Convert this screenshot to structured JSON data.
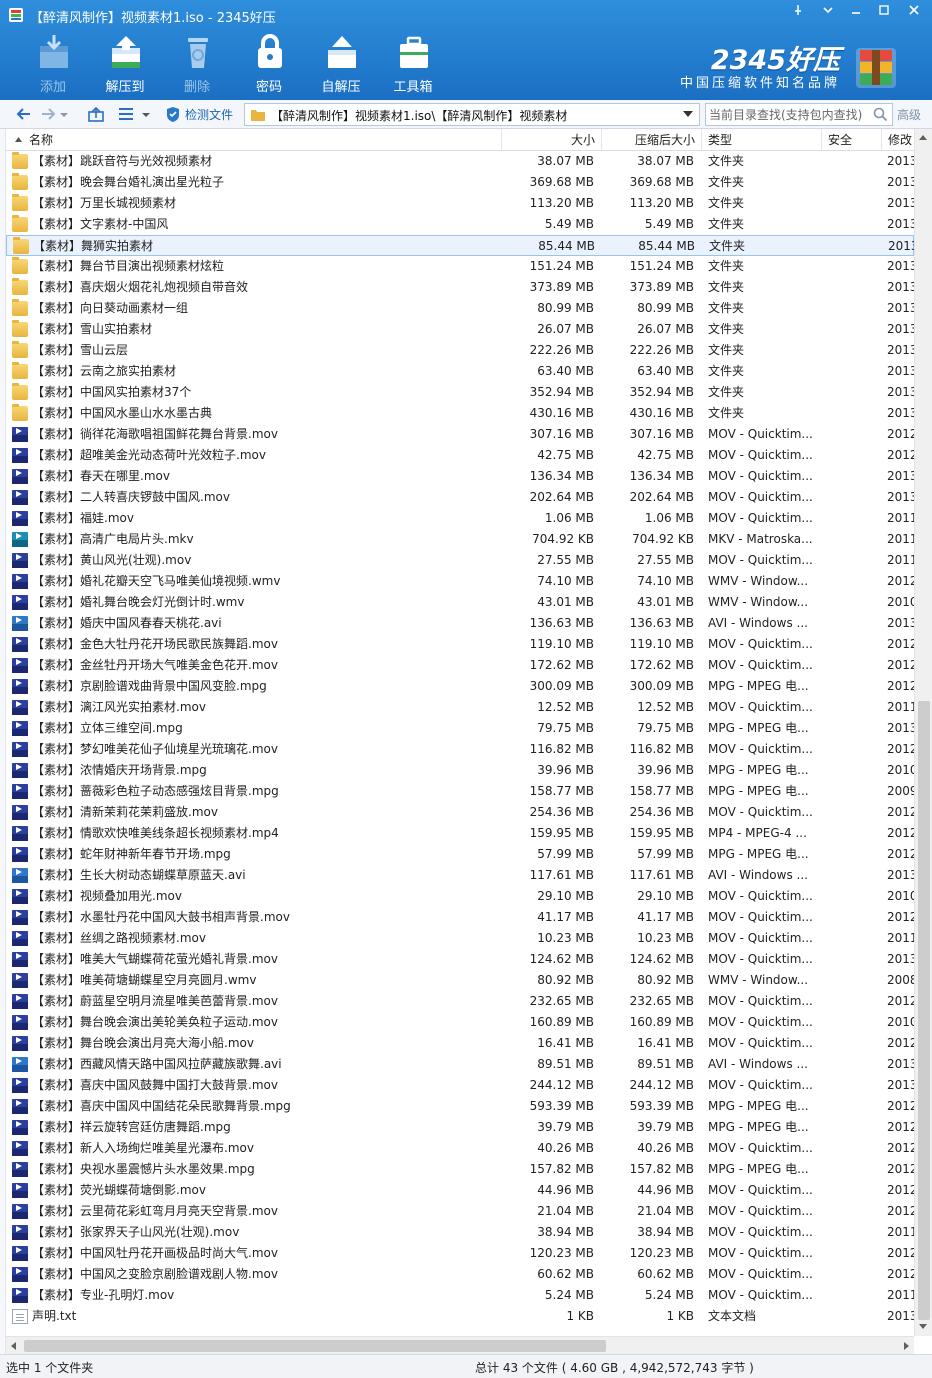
{
  "window": {
    "title": "【醉清风制作】视频素材1.iso - 2345好压",
    "controls": [
      "pin-icon",
      "menu-icon",
      "minimize-icon",
      "maximize-icon",
      "close-icon"
    ]
  },
  "toolbar": {
    "add_label": "添加",
    "extract_label": "解压到",
    "delete_label": "删除",
    "password_label": "密码",
    "sfx_label": "自解压",
    "toolbox_label": "工具箱"
  },
  "brand": {
    "name": "2345好压",
    "slogan": "中国压缩软件知名品牌"
  },
  "addressbar": {
    "detect_label": "检测文件",
    "path": "【醉清风制作】视频素材1.iso\\【醉清风制作】视频素材",
    "search_placeholder": "当前目录查找(支持包内查找)",
    "advanced_label": "高级"
  },
  "columns": {
    "name": "名称",
    "size": "大小",
    "compressed": "压缩后大小",
    "type": "类型",
    "security": "安全",
    "modified": "修改"
  },
  "files": [
    {
      "icon": "folder",
      "name": "【素材】跳跃音符与光效视频素材",
      "size": "38.07 MB",
      "csize": "38.07 MB",
      "type": "文件夹",
      "date": "2013"
    },
    {
      "icon": "folder",
      "name": "【素材】晚会舞台婚礼演出星光粒子",
      "size": "369.68 MB",
      "csize": "369.68 MB",
      "type": "文件夹",
      "date": "2013"
    },
    {
      "icon": "folder",
      "name": "【素材】万里长城视频素材",
      "size": "113.20 MB",
      "csize": "113.20 MB",
      "type": "文件夹",
      "date": "2013"
    },
    {
      "icon": "folder",
      "name": "【素材】文字素材-中国风",
      "size": "5.49 MB",
      "csize": "5.49 MB",
      "type": "文件夹",
      "date": "2013"
    },
    {
      "icon": "folder",
      "name": "【素材】舞狮实拍素材",
      "size": "85.44 MB",
      "csize": "85.44 MB",
      "type": "文件夹",
      "date": "2013",
      "selected": true
    },
    {
      "icon": "folder",
      "name": "【素材】舞台节目演出视频素材炫粒",
      "size": "151.24 MB",
      "csize": "151.24 MB",
      "type": "文件夹",
      "date": "2013"
    },
    {
      "icon": "folder",
      "name": "【素材】喜庆烟火烟花礼炮视频自带音效",
      "size": "373.89 MB",
      "csize": "373.89 MB",
      "type": "文件夹",
      "date": "2013"
    },
    {
      "icon": "folder",
      "name": "【素材】向日葵动画素材一组",
      "size": "80.99 MB",
      "csize": "80.99 MB",
      "type": "文件夹",
      "date": "2013"
    },
    {
      "icon": "folder",
      "name": "【素材】雪山实拍素材",
      "size": "26.07 MB",
      "csize": "26.07 MB",
      "type": "文件夹",
      "date": "2013"
    },
    {
      "icon": "folder",
      "name": "【素材】雪山云层",
      "size": "222.26 MB",
      "csize": "222.26 MB",
      "type": "文件夹",
      "date": "2013"
    },
    {
      "icon": "folder",
      "name": "【素材】云南之旅实拍素材",
      "size": "63.40 MB",
      "csize": "63.40 MB",
      "type": "文件夹",
      "date": "2013"
    },
    {
      "icon": "folder",
      "name": "【素材】中国风实拍素材37个",
      "size": "352.94 MB",
      "csize": "352.94 MB",
      "type": "文件夹",
      "date": "2013"
    },
    {
      "icon": "folder",
      "name": "【素材】中国风水墨山水水墨古典",
      "size": "430.16 MB",
      "csize": "430.16 MB",
      "type": "文件夹",
      "date": "2013"
    },
    {
      "icon": "mov",
      "name": "【素材】徜徉花海歌唱祖国鲜花舞台背景.mov",
      "size": "307.16 MB",
      "csize": "307.16 MB",
      "type": "MOV - Quicktim...",
      "date": "2012"
    },
    {
      "icon": "mov",
      "name": "【素材】超唯美金光动态荷叶光效粒子.mov",
      "size": "42.75 MB",
      "csize": "42.75 MB",
      "type": "MOV - Quicktim...",
      "date": "2012"
    },
    {
      "icon": "mov",
      "name": "【素材】春天在哪里.mov",
      "size": "136.34 MB",
      "csize": "136.34 MB",
      "type": "MOV - Quicktim...",
      "date": "2013"
    },
    {
      "icon": "mov",
      "name": "【素材】二人转喜庆锣鼓中国风.mov",
      "size": "202.64 MB",
      "csize": "202.64 MB",
      "type": "MOV - Quicktim...",
      "date": "2013"
    },
    {
      "icon": "mov",
      "name": "【素材】福娃.mov",
      "size": "1.06 MB",
      "csize": "1.06 MB",
      "type": "MOV - Quicktim...",
      "date": "2011"
    },
    {
      "icon": "mkv",
      "name": "【素材】高清广电局片头.mkv",
      "size": "704.92 KB",
      "csize": "704.92 KB",
      "type": "MKV - Matroska...",
      "date": "2011"
    },
    {
      "icon": "mov",
      "name": "【素材】黄山风光(壮观).mov",
      "size": "27.55 MB",
      "csize": "27.55 MB",
      "type": "MOV - Quicktim...",
      "date": "2011"
    },
    {
      "icon": "wmv",
      "name": "【素材】婚礼花瓣天空飞马唯美仙境视频.wmv",
      "size": "74.10 MB",
      "csize": "74.10 MB",
      "type": "WMV - Window...",
      "date": "2012"
    },
    {
      "icon": "wmv",
      "name": "【素材】婚礼舞台晚会灯光倒计时.wmv",
      "size": "43.01 MB",
      "csize": "43.01 MB",
      "type": "WMV - Window...",
      "date": "2010"
    },
    {
      "icon": "avi",
      "name": "【素材】婚庆中国风春春天桃花.avi",
      "size": "136.63 MB",
      "csize": "136.63 MB",
      "type": "AVI - Windows ...",
      "date": "2013"
    },
    {
      "icon": "mov",
      "name": "【素材】金色大牡丹花开场民歌民族舞蹈.mov",
      "size": "119.10 MB",
      "csize": "119.10 MB",
      "type": "MOV - Quicktim...",
      "date": "2012"
    },
    {
      "icon": "mov",
      "name": "【素材】金丝牡丹开场大气唯美金色花开.mov",
      "size": "172.62 MB",
      "csize": "172.62 MB",
      "type": "MOV - Quicktim...",
      "date": "2012"
    },
    {
      "icon": "mpg",
      "name": "【素材】京剧脸谱戏曲背景中国风变脸.mpg",
      "size": "300.09 MB",
      "csize": "300.09 MB",
      "type": "MPG - MPEG 电...",
      "date": "2012"
    },
    {
      "icon": "mov",
      "name": "【素材】漓江风光实拍素材.mov",
      "size": "12.52 MB",
      "csize": "12.52 MB",
      "type": "MOV - Quicktim...",
      "date": "2011"
    },
    {
      "icon": "mpg",
      "name": "【素材】立体三维空间.mpg",
      "size": "79.75 MB",
      "csize": "79.75 MB",
      "type": "MPG - MPEG 电...",
      "date": "2013"
    },
    {
      "icon": "mov",
      "name": "【素材】梦幻唯美花仙子仙境星光琉璃花.mov",
      "size": "116.82 MB",
      "csize": "116.82 MB",
      "type": "MOV - Quicktim...",
      "date": "2012"
    },
    {
      "icon": "mpg",
      "name": "【素材】浓情婚庆开场背景.mpg",
      "size": "39.96 MB",
      "csize": "39.96 MB",
      "type": "MPG - MPEG 电...",
      "date": "2010"
    },
    {
      "icon": "mpg",
      "name": "【素材】蔷薇彩色粒子动态感强炫目背景.mpg",
      "size": "158.77 MB",
      "csize": "158.77 MB",
      "type": "MPG - MPEG 电...",
      "date": "2009"
    },
    {
      "icon": "mov",
      "name": "【素材】清新茉莉花茉莉盛放.mov",
      "size": "254.36 MB",
      "csize": "254.36 MB",
      "type": "MOV - Quicktim...",
      "date": "2012"
    },
    {
      "icon": "mp4",
      "name": "【素材】情歌欢快唯美线条超长视频素材.mp4",
      "size": "159.95 MB",
      "csize": "159.95 MB",
      "type": "MP4 - MPEG-4 ...",
      "date": "2012"
    },
    {
      "icon": "mpg",
      "name": "【素材】蛇年财神新年春节开场.mpg",
      "size": "57.99 MB",
      "csize": "57.99 MB",
      "type": "MPG - MPEG 电...",
      "date": "2012"
    },
    {
      "icon": "avi",
      "name": "【素材】生长大树动态蝴蝶草原蓝天.avi",
      "size": "117.61 MB",
      "csize": "117.61 MB",
      "type": "AVI - Windows ...",
      "date": "2013"
    },
    {
      "icon": "mov",
      "name": "【素材】视频叠加用光.mov",
      "size": "29.10 MB",
      "csize": "29.10 MB",
      "type": "MOV - Quicktim...",
      "date": "2010"
    },
    {
      "icon": "mov",
      "name": "【素材】水墨牡丹花中国风大鼓书相声背景.mov",
      "size": "41.17 MB",
      "csize": "41.17 MB",
      "type": "MOV - Quicktim...",
      "date": "2012"
    },
    {
      "icon": "mov",
      "name": "【素材】丝绸之路视频素材.mov",
      "size": "10.23 MB",
      "csize": "10.23 MB",
      "type": "MOV - Quicktim...",
      "date": "2011"
    },
    {
      "icon": "mov",
      "name": "【素材】唯美大气蝴蝶荷花萤光婚礼背景.mov",
      "size": "124.62 MB",
      "csize": "124.62 MB",
      "type": "MOV - Quicktim...",
      "date": "2013"
    },
    {
      "icon": "wmv",
      "name": "【素材】唯美荷塘蝴蝶星空月亮圆月.wmv",
      "size": "80.92 MB",
      "csize": "80.92 MB",
      "type": "WMV - Window...",
      "date": "2008"
    },
    {
      "icon": "mov",
      "name": "【素材】蔚蓝星空明月流星唯美芭蕾背景.mov",
      "size": "232.65 MB",
      "csize": "232.65 MB",
      "type": "MOV - Quicktim...",
      "date": "2012"
    },
    {
      "icon": "mov",
      "name": "【素材】舞台晚会演出美轮美奂粒子运动.mov",
      "size": "160.89 MB",
      "csize": "160.89 MB",
      "type": "MOV - Quicktim...",
      "date": "2010"
    },
    {
      "icon": "mov",
      "name": "【素材】舞台晚会演出月亮大海小船.mov",
      "size": "16.41 MB",
      "csize": "16.41 MB",
      "type": "MOV - Quicktim...",
      "date": "2012"
    },
    {
      "icon": "avi",
      "name": "【素材】西藏风情天路中国风拉萨藏族歌舞.avi",
      "size": "89.51 MB",
      "csize": "89.51 MB",
      "type": "AVI - Windows ...",
      "date": "2013"
    },
    {
      "icon": "mov",
      "name": "【素材】喜庆中国风鼓舞中国打大鼓背景.mov",
      "size": "244.12 MB",
      "csize": "244.12 MB",
      "type": "MOV - Quicktim...",
      "date": "2013"
    },
    {
      "icon": "mpg",
      "name": "【素材】喜庆中国风中国结花朵民歌舞背景.mpg",
      "size": "593.39 MB",
      "csize": "593.39 MB",
      "type": "MPG - MPEG 电...",
      "date": "2012"
    },
    {
      "icon": "mpg",
      "name": "【素材】祥云旋转宫廷仿唐舞蹈.mpg",
      "size": "39.79 MB",
      "csize": "39.79 MB",
      "type": "MPG - MPEG 电...",
      "date": "2012"
    },
    {
      "icon": "mov",
      "name": "【素材】新人入场绚烂唯美星光瀑布.mov",
      "size": "40.26 MB",
      "csize": "40.26 MB",
      "type": "MOV - Quicktim...",
      "date": "2012"
    },
    {
      "icon": "mpg",
      "name": "【素材】央视水墨震憾片头水墨效果.mpg",
      "size": "157.82 MB",
      "csize": "157.82 MB",
      "type": "MPG - MPEG 电...",
      "date": "2012"
    },
    {
      "icon": "mov",
      "name": "【素材】荧光蝴蝶荷塘倒影.mov",
      "size": "44.96 MB",
      "csize": "44.96 MB",
      "type": "MOV - Quicktim...",
      "date": "2012"
    },
    {
      "icon": "mov",
      "name": "【素材】云里荷花彩虹弯月月亮天空背景.mov",
      "size": "21.04 MB",
      "csize": "21.04 MB",
      "type": "MOV - Quicktim...",
      "date": "2012"
    },
    {
      "icon": "mov",
      "name": "【素材】张家界天子山风光(壮观).mov",
      "size": "38.94 MB",
      "csize": "38.94 MB",
      "type": "MOV - Quicktim...",
      "date": "2011"
    },
    {
      "icon": "mov",
      "name": "【素材】中国风牡丹花开画极品时尚大气.mov",
      "size": "120.23 MB",
      "csize": "120.23 MB",
      "type": "MOV - Quicktim...",
      "date": "2012"
    },
    {
      "icon": "mov",
      "name": "【素材】中国风之变脸京剧脸谱戏剧人物.mov",
      "size": "60.62 MB",
      "csize": "60.62 MB",
      "type": "MOV - Quicktim...",
      "date": "2012"
    },
    {
      "icon": "mov",
      "name": "【素材】专业-孔明灯.mov",
      "size": "5.24 MB",
      "csize": "5.24 MB",
      "type": "MOV - Quicktim...",
      "date": "2011"
    },
    {
      "icon": "txt",
      "name": "声明.txt",
      "size": "1 KB",
      "csize": "1 KB",
      "type": "文本文档",
      "date": "2013"
    }
  ],
  "status": {
    "selection": "选中 1 个文件夹",
    "summary": "总计 43 个文件 ( 4.60 GB , 4,942,572,743 字节 )"
  },
  "colors": {
    "toolbar_bg": "#2384d6",
    "selection_bg": "#e9f2fd",
    "folder": "#f0c24f",
    "video_icon": "#2a3f9e"
  }
}
